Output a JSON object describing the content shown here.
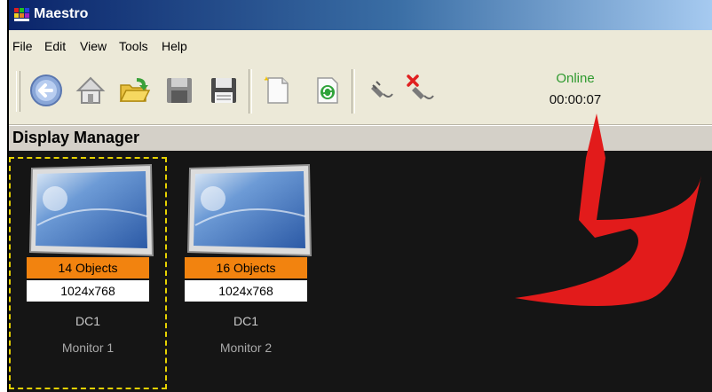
{
  "window": {
    "title": "Maestro"
  },
  "menu": [
    {
      "label": "File"
    },
    {
      "label": "Edit"
    },
    {
      "label": "View"
    },
    {
      "label": "Tools"
    },
    {
      "label": "Help"
    }
  ],
  "toolbar": {
    "buttons": [
      "back-icon",
      "home-icon",
      "open-folder-icon",
      "disk-grey-icon",
      "save-icon",
      "new-page-icon",
      "refresh-page-icon",
      "connect-plug-icon",
      "disconnect-plug-icon"
    ]
  },
  "status": {
    "state": "Online",
    "timer": "00:00:07",
    "state_color": "#2f9a2f"
  },
  "section": {
    "title": "Display Manager"
  },
  "monitors": [
    {
      "objects": "14 Objects",
      "resolution": "1024x768",
      "dc": "DC1",
      "name": "Monitor 1",
      "selected": true
    },
    {
      "objects": "16 Objects",
      "resolution": "1024x768",
      "dc": "DC1",
      "name": "Monitor 2",
      "selected": false
    }
  ],
  "colors": {
    "objects_badge": "#f2830f",
    "canvas": "#151515",
    "selection": "#e6d200",
    "annotation_arrow": "#e21b1b"
  }
}
